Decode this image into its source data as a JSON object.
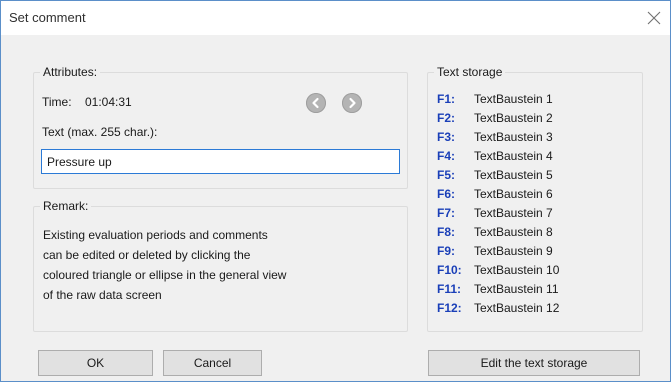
{
  "window": {
    "title": "Set comment",
    "close_icon": "close-icon"
  },
  "attributes": {
    "legend": "Attributes:",
    "time_label": "Time:",
    "time_value": "01:04:31",
    "prev_icon": "arrow-left-icon",
    "next_icon": "arrow-right-icon",
    "text_label": "Text (max. 255 char.):",
    "text_value": "Pressure up"
  },
  "remark": {
    "legend": "Remark:",
    "lines": [
      "Existing evaluation periods and comments",
      "can be edited or deleted by clicking the",
      "coloured triangle or ellipse in the general view",
      "of the raw data screen"
    ]
  },
  "text_storage": {
    "legend": "Text storage",
    "key_color": "#1a3fb8",
    "items": [
      {
        "key": "F1:",
        "value": "TextBaustein 1"
      },
      {
        "key": "F2:",
        "value": "TextBaustein 2"
      },
      {
        "key": "F3:",
        "value": "TextBaustein 3"
      },
      {
        "key": "F4:",
        "value": "TextBaustein 4"
      },
      {
        "key": "F5:",
        "value": "TextBaustein 5"
      },
      {
        "key": "F6:",
        "value": "TextBaustein 6"
      },
      {
        "key": "F7:",
        "value": "TextBaustein 7"
      },
      {
        "key": "F8:",
        "value": "TextBaustein 8"
      },
      {
        "key": "F9:",
        "value": "TextBaustein 9"
      },
      {
        "key": "F10:",
        "value": "TextBaustein 10"
      },
      {
        "key": "F11:",
        "value": "TextBaustein 11"
      },
      {
        "key": "F12:",
        "value": "TextBaustein 12"
      }
    ]
  },
  "buttons": {
    "ok": "OK",
    "cancel": "Cancel",
    "edit_storage": "Edit the text storage"
  }
}
